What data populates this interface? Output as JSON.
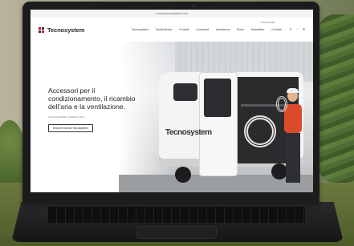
{
  "topbar": {
    "text": "● www.tecnosystemi.com"
  },
  "header": {
    "logo_text": "Tecnosystem",
    "menu": [
      "Tecnosystemi",
      "Novità Brand",
      "Prodotti",
      "Download",
      "Assistenza",
      "Press",
      "Newsletter",
      "Contatti"
    ],
    "langs": "IT  EN  FR  DE",
    "icons": [
      "search-icon",
      "user-icon",
      "menu-icon"
    ]
  },
  "hero": {
    "title": "Accessori per il condizionamento, il ricambio dell’aria e la ventilazione.",
    "subtitle": "ITALIA & EUROPA · MADE IN ITALY",
    "button": "Entra nel mondo Tecnosystemi",
    "van_logo": "Tecnosystem"
  }
}
